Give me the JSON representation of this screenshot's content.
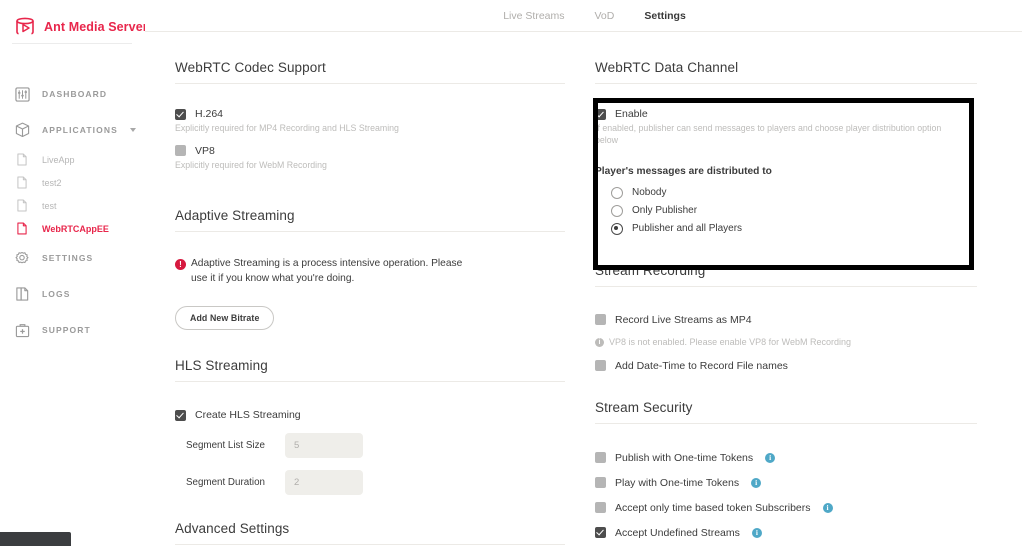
{
  "brand": {
    "name": "Ant Media Server",
    "color": "#e8264b",
    "logo_icon": "ant-media-logo-icon"
  },
  "sidebar": {
    "items": [
      {
        "label": "DASHBOARD",
        "icon": "dashboard-icon"
      },
      {
        "label": "APPLICATIONS",
        "icon": "applications-box-icon",
        "caret": true
      }
    ],
    "applications": [
      {
        "label": "LiveApp",
        "icon": "file-icon",
        "active": false
      },
      {
        "label": "test2",
        "icon": "file-icon",
        "active": false
      },
      {
        "label": "test",
        "icon": "file-icon",
        "active": false
      },
      {
        "label": "WebRTCAppEE",
        "icon": "file-icon",
        "active": true
      }
    ],
    "items_bottom": [
      {
        "label": "SETTINGS",
        "icon": "gear-icon"
      },
      {
        "label": "LOGS",
        "icon": "logs-icon"
      },
      {
        "label": "SUPPORT",
        "icon": "support-briefcase-icon"
      }
    ]
  },
  "tabs": [
    {
      "label": "Live Streams",
      "active": false
    },
    {
      "label": "VoD",
      "active": false
    },
    {
      "label": "Settings",
      "active": true
    }
  ],
  "left": {
    "codec": {
      "title": "WebRTC Codec Support",
      "h264": {
        "label": "H.264",
        "checked": true,
        "hint": "Explicitly required for MP4 Recording and HLS Streaming"
      },
      "vp8": {
        "label": "VP8",
        "checked": false,
        "hint": "Explicitly required for WebM Recording"
      }
    },
    "adaptive": {
      "title": "Adaptive Streaming",
      "warning": "Adaptive Streaming is a process intensive operation. Please use it if you know what you're doing.",
      "add_bitrate_label": "Add New Bitrate"
    },
    "hls": {
      "title": "HLS Streaming",
      "create_hls": {
        "label": "Create HLS Streaming",
        "checked": true
      },
      "segment_list_size": {
        "label": "Segment List Size",
        "value": "5"
      },
      "segment_duration": {
        "label": "Segment Duration",
        "value": "2"
      }
    },
    "advanced": {
      "title": "Advanced Settings"
    }
  },
  "right": {
    "data_channel": {
      "title": "WebRTC Data Channel",
      "enable": {
        "label": "Enable",
        "checked": true
      },
      "enable_hint": "If enabled, publisher can send messages to players and choose player distribution option below",
      "distribution_title": "Player's messages are distributed to",
      "options": [
        {
          "label": "Nobody",
          "selected": false
        },
        {
          "label": "Only Publisher",
          "selected": false
        },
        {
          "label": "Publisher and all Players",
          "selected": true
        }
      ],
      "highlight_color": "#000000"
    },
    "recording": {
      "title": "Stream Recording",
      "record_mp4": {
        "label": "Record Live Streams as MP4",
        "checked": false
      },
      "vp8_note": "VP8 is not enabled. Please enable VP8 for WebM Recording",
      "add_datetime": {
        "label": "Add Date-Time to Record File names",
        "checked": false
      }
    },
    "security": {
      "title": "Stream Security",
      "items": [
        {
          "label": "Publish with One-time Tokens",
          "checked": false,
          "info": true
        },
        {
          "label": "Play with One-time Tokens",
          "checked": false,
          "info": true
        },
        {
          "label": "Accept only time based token Subscribers",
          "checked": false,
          "info": true
        },
        {
          "label": "Accept Undefined Streams",
          "checked": true,
          "info": true
        }
      ]
    }
  },
  "bottom_bar": {
    "text": ""
  }
}
